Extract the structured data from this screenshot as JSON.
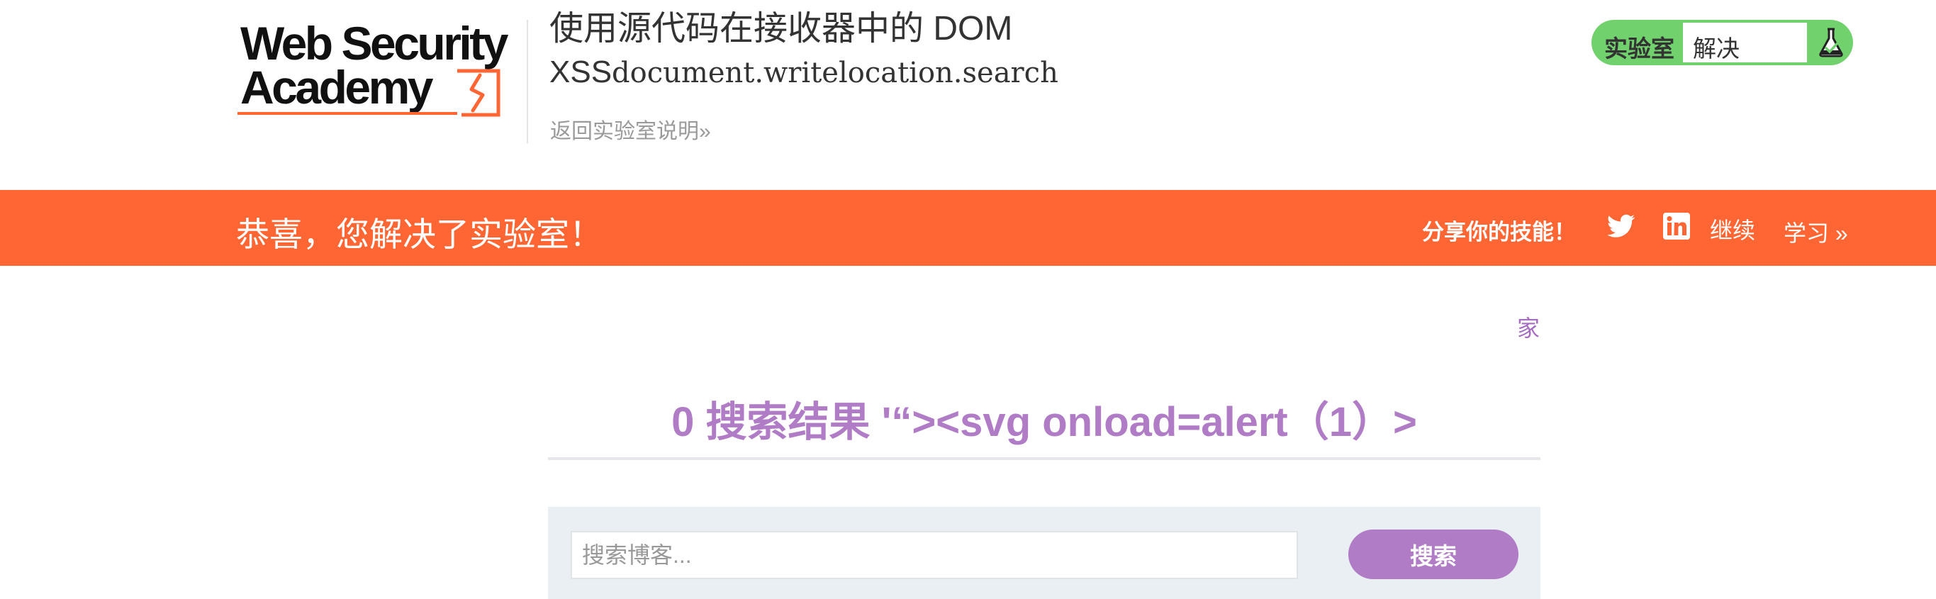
{
  "header": {
    "logo": {
      "line1": "Web Security",
      "line2": "Academy"
    },
    "lab_title_line1": "使用源代码在接收器中的 DOM",
    "lab_title_line2_prefix": "XSS",
    "lab_title_line2_code": "document.writelocation.search",
    "back_link": "返回实验室说明",
    "back_link_glyph": "»",
    "lab_status": {
      "label": "实验室",
      "value": "解决",
      "icon": "flask-icon"
    }
  },
  "banner": {
    "message": "恭喜，您解决了实验室！",
    "share_text": "分享你的技能！",
    "icons": [
      "twitter-icon",
      "linkedin-icon"
    ],
    "continue_label": "继续",
    "learn_label": "学习",
    "learn_glyph": "»"
  },
  "main": {
    "home_link": "家",
    "results_title": "0 搜索结果 '“><svg onload=alert（1）>",
    "search": {
      "placeholder": "搜索博客...",
      "value": "",
      "button_label": "搜索"
    }
  },
  "colors": {
    "accent_orange": "#ff6633",
    "accent_purple": "#b07cc6",
    "status_green": "#70d16d",
    "panel_bg": "#e9eff2"
  }
}
